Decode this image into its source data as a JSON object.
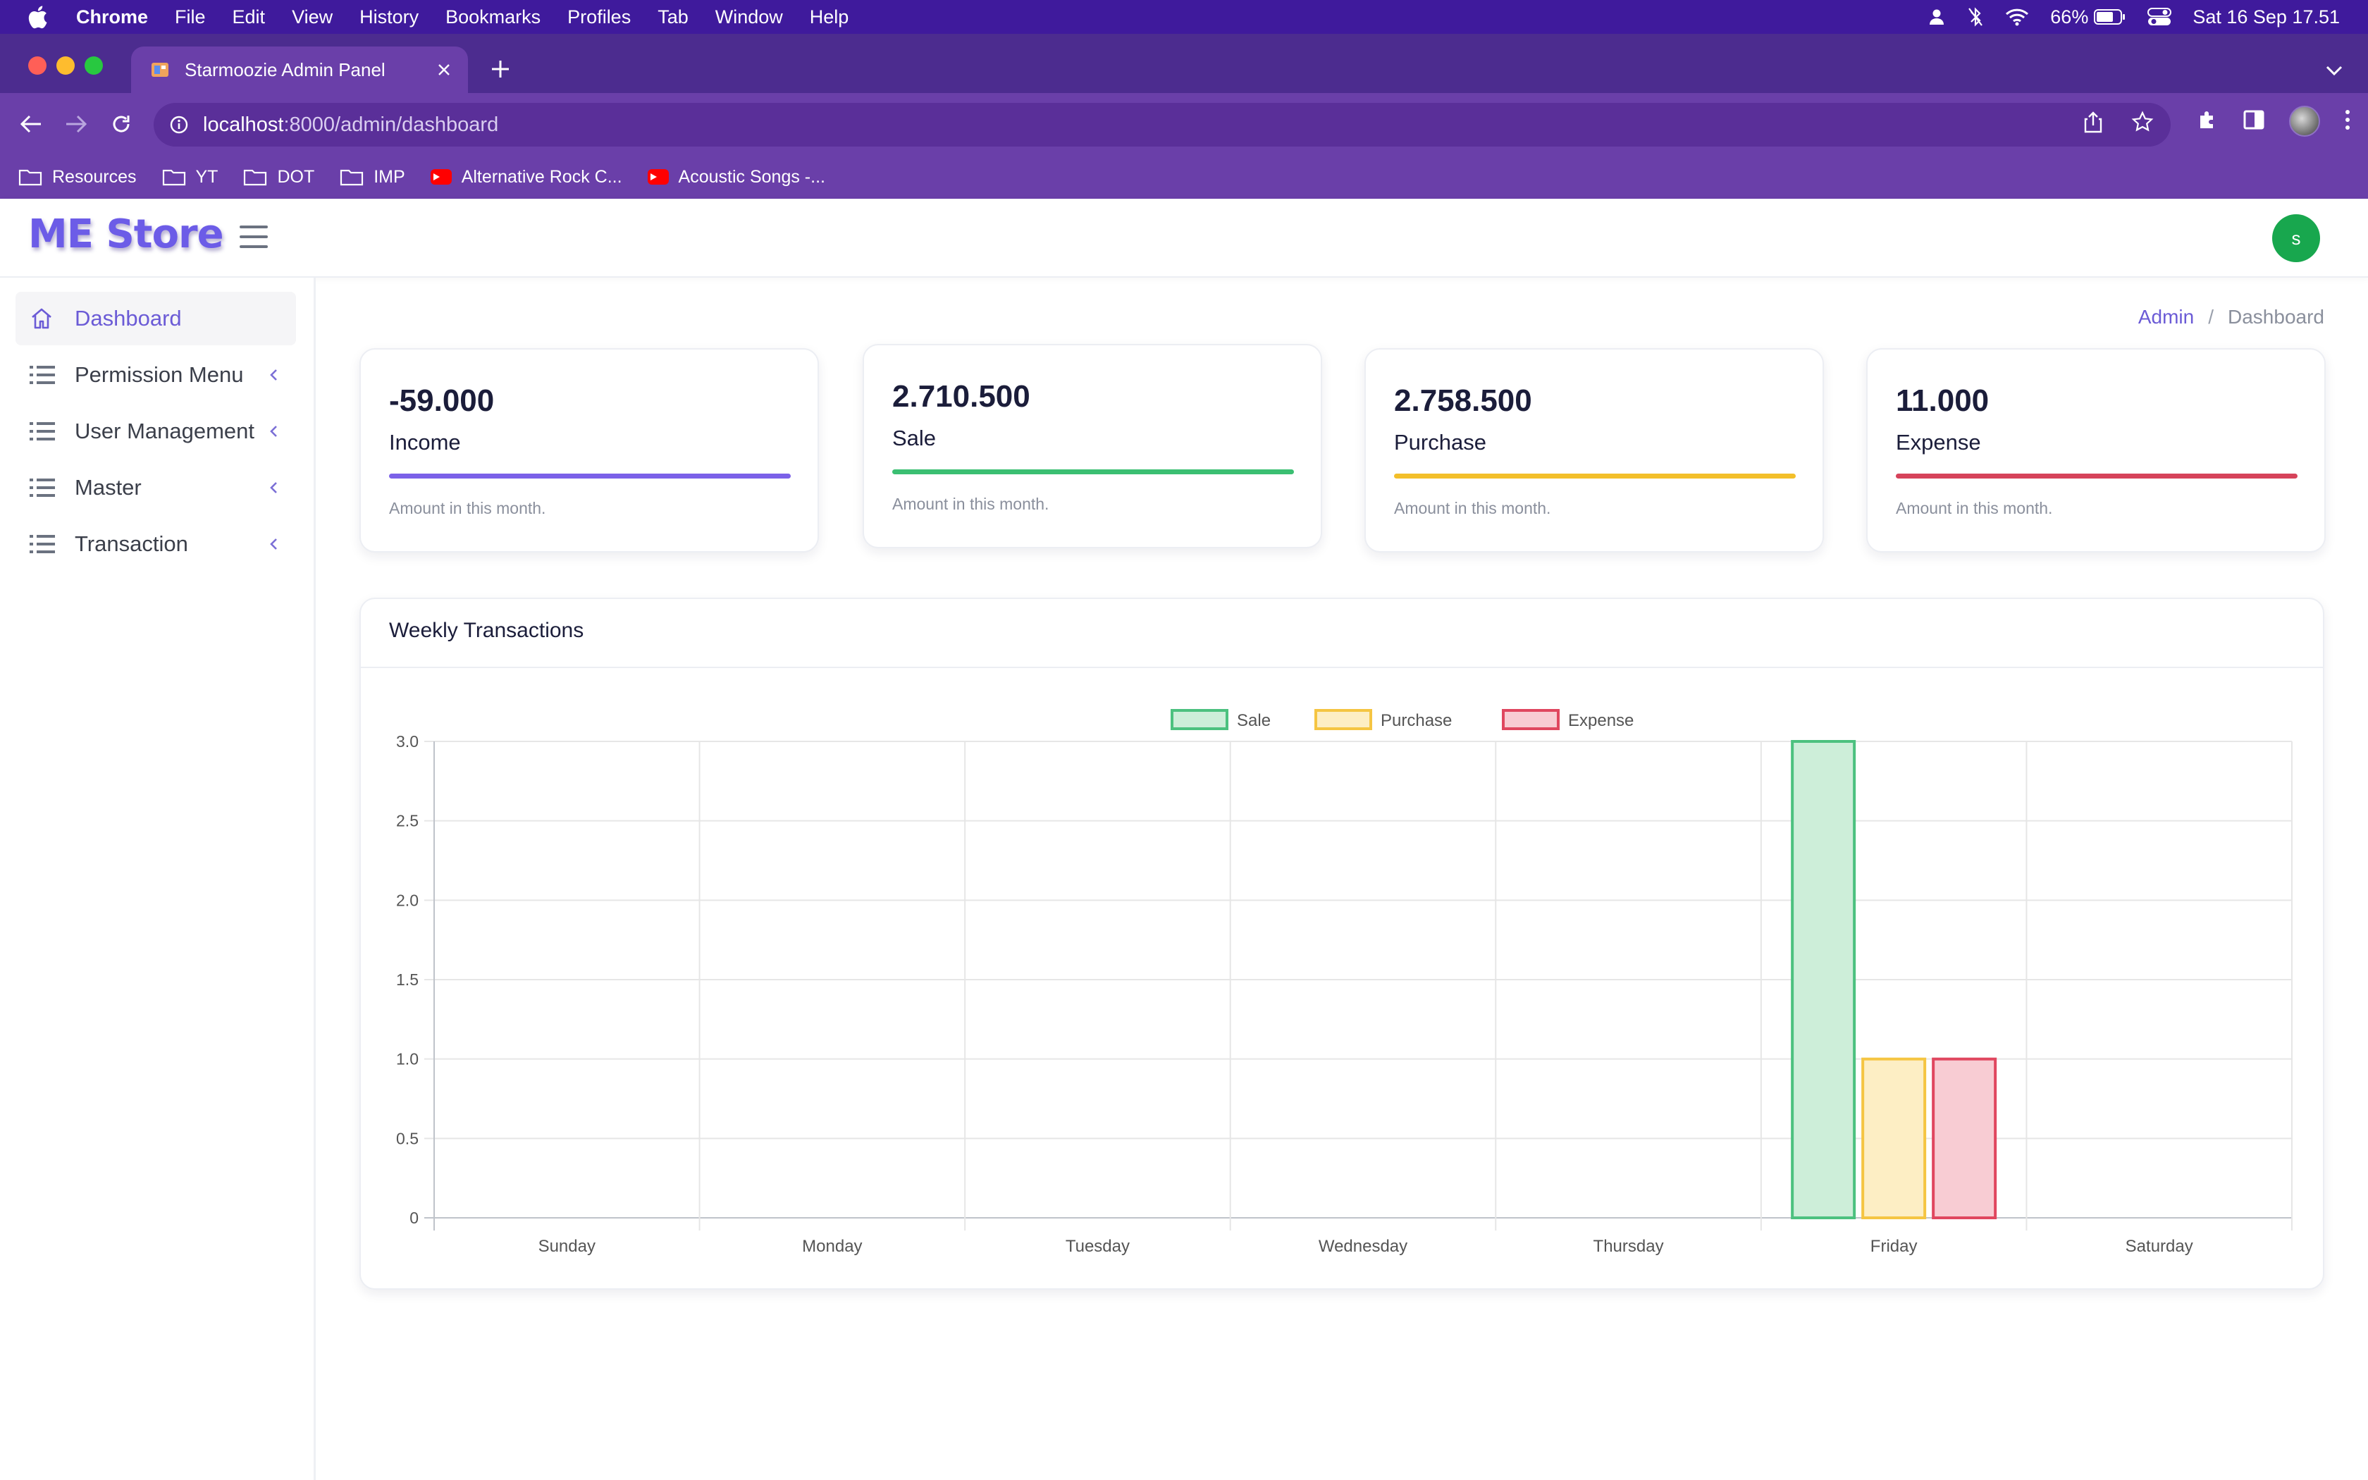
{
  "menubar": {
    "items": [
      "Chrome",
      "File",
      "Edit",
      "View",
      "History",
      "Bookmarks",
      "Profiles",
      "Tab",
      "Window",
      "Help"
    ],
    "battery": "66%",
    "datetime": "Sat 16 Sep  17.51"
  },
  "browser": {
    "tab_title": "Starmoozie Admin Panel",
    "url_host": "localhost",
    "url_path": ":8000/admin/dashboard",
    "bookmarks": [
      {
        "label": "Resources",
        "icon": "folder-icon"
      },
      {
        "label": "YT",
        "icon": "folder-icon"
      },
      {
        "label": "DOT",
        "icon": "folder-icon"
      },
      {
        "label": "IMP",
        "icon": "folder-icon"
      },
      {
        "label": "Alternative Rock C...",
        "icon": "youtube-icon"
      },
      {
        "label": "Acoustic Songs -...",
        "icon": "youtube-icon"
      }
    ]
  },
  "header": {
    "logo": "ME Store",
    "avatar_initial": "s"
  },
  "sidebar": {
    "items": [
      {
        "label": "Dashboard",
        "icon": "home-icon"
      },
      {
        "label": "Permission Menu",
        "icon": "list-icon"
      },
      {
        "label": "User Management",
        "icon": "list-icon"
      },
      {
        "label": "Master",
        "icon": "list-icon"
      },
      {
        "label": "Transaction",
        "icon": "list-icon"
      }
    ]
  },
  "breadcrumb": {
    "admin": "Admin",
    "separator": "/",
    "current": "Dashboard"
  },
  "stats": [
    {
      "value": "-59.000",
      "label": "Income",
      "note": "Amount in this month.",
      "color": "#7b61e8"
    },
    {
      "value": "2.710.500",
      "label": "Sale",
      "note": "Amount in this month.",
      "color": "#3bbf72"
    },
    {
      "value": "2.758.500",
      "label": "Purchase",
      "note": "Amount in this month.",
      "color": "#f3bf2a"
    },
    {
      "value": "11.000",
      "label": "Expense",
      "note": "Amount in this month.",
      "color": "#d6435a"
    }
  ],
  "chart": {
    "title": "Weekly Transactions"
  },
  "chart_data": {
    "type": "bar",
    "categories": [
      "Sunday",
      "Monday",
      "Tuesday",
      "Wednesday",
      "Thursday",
      "Friday",
      "Saturday"
    ],
    "series": [
      {
        "name": "Sale",
        "values": [
          0,
          0,
          0,
          0,
          0,
          3,
          0
        ],
        "stroke": "#4cc17f",
        "fill": "#cdeed9"
      },
      {
        "name": "Purchase",
        "values": [
          0,
          0,
          0,
          0,
          0,
          1,
          0
        ],
        "stroke": "#f5c542",
        "fill": "#fdeec4"
      },
      {
        "name": "Expense",
        "values": [
          0,
          0,
          0,
          0,
          0,
          1,
          0
        ],
        "stroke": "#e0475f",
        "fill": "#f8ccd3"
      }
    ],
    "yticks": [
      "0",
      "0.5",
      "1.0",
      "1.5",
      "2.0",
      "2.5",
      "3.0"
    ],
    "ylim": [
      0,
      3
    ],
    "grid": true,
    "legend": "top-center"
  }
}
